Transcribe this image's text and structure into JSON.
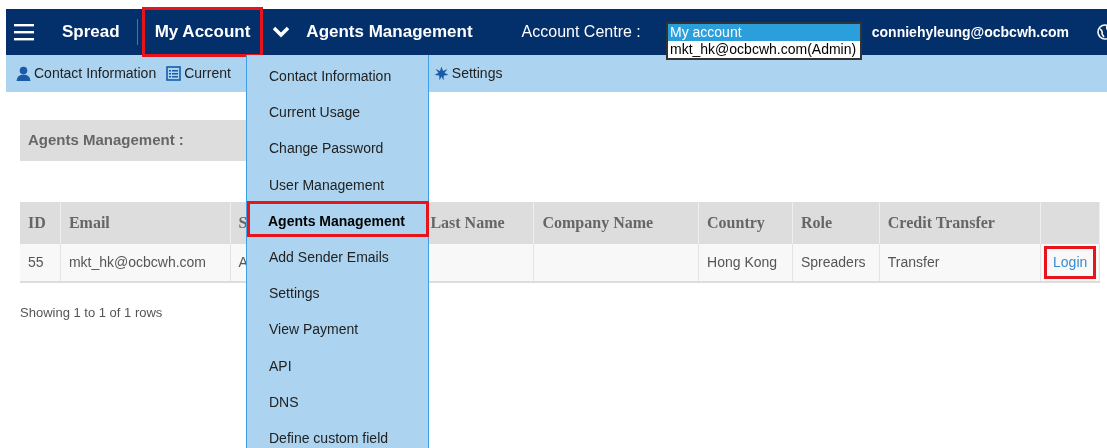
{
  "navbar": {
    "brand": "Spread",
    "items": [
      {
        "label": "My Account",
        "highlighted": true
      },
      {
        "label": "Agents Management",
        "highlighted": false
      }
    ],
    "account_centre": {
      "label": "Account Centre :",
      "options": [
        {
          "label": "My account",
          "selected": true
        },
        {
          "label": "mkt_hk@ocbcwh.com(Admin)",
          "selected": false
        }
      ]
    },
    "user_email": "conniehyleung@ocbcwh.com"
  },
  "subnav": {
    "items": [
      {
        "label": "Contact Information",
        "kind": "person"
      },
      {
        "label": "Current",
        "kind": "table"
      },
      {
        "label": "Settings",
        "kind": "gear"
      }
    ]
  },
  "section_title": "Agents Management :",
  "table": {
    "columns": [
      "ID",
      "Email",
      "S",
      "Last Name",
      "Company Name",
      "Country",
      "Role",
      "Credit Transfer"
    ],
    "rows": [
      {
        "cells": [
          "55",
          "mkt_hk@ocbcwh.com",
          "A",
          "",
          "",
          "Hong Kong",
          "Spreaders",
          "Transfer"
        ],
        "action": {
          "label": "Login",
          "highlighted": true
        }
      }
    ]
  },
  "pagination_info": "Showing 1 to 1 of 1 rows",
  "dropdown_menu": {
    "items": [
      {
        "label": "Contact Information",
        "selected": false
      },
      {
        "label": "Current Usage",
        "selected": false
      },
      {
        "label": "Change Password",
        "selected": false
      },
      {
        "label": "User Management",
        "selected": false
      },
      {
        "label": "Agents Management",
        "selected": true
      },
      {
        "label": "Add Sender Emails",
        "selected": false
      },
      {
        "label": "Settings",
        "selected": false
      },
      {
        "label": "View Payment",
        "selected": false
      },
      {
        "label": "API",
        "selected": false
      },
      {
        "label": "DNS",
        "selected": false
      },
      {
        "label": "Define custom field",
        "selected": false
      }
    ]
  }
}
